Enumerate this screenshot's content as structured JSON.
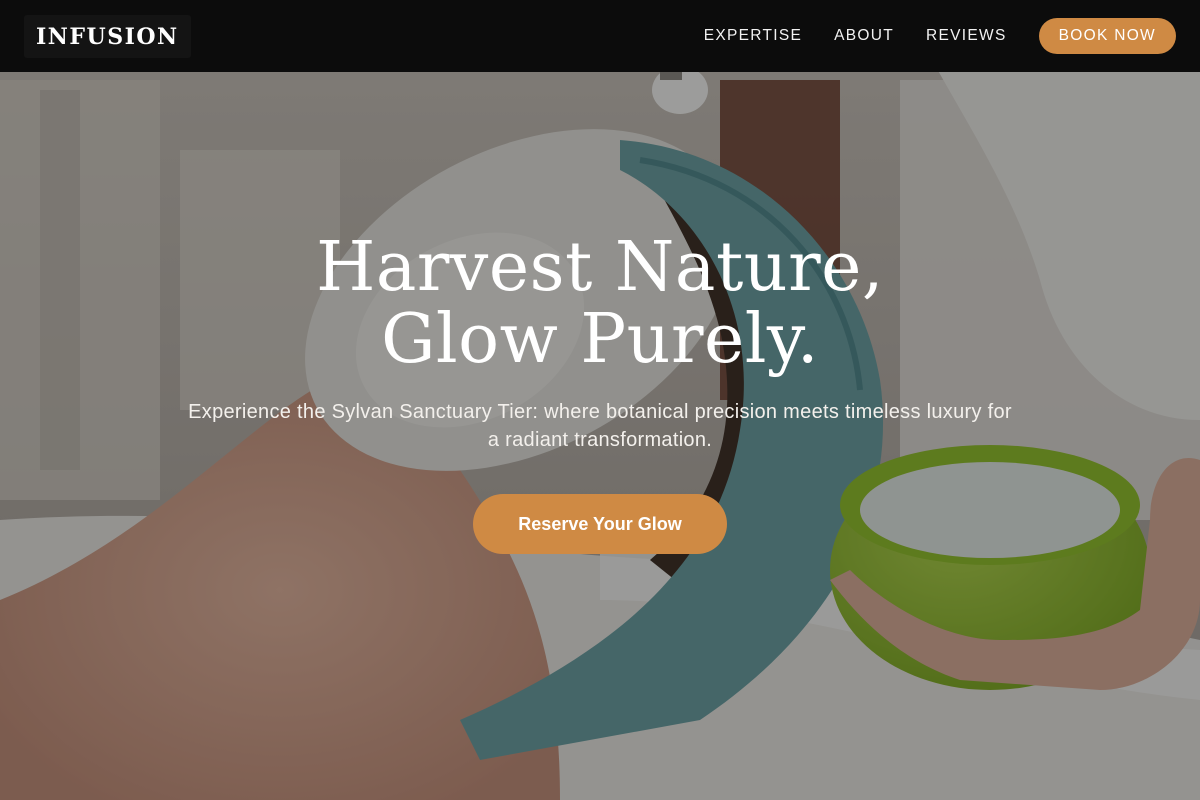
{
  "header": {
    "logo": "INFUSION",
    "nav": {
      "expertise": "EXPERTISE",
      "about": "ABOUT",
      "reviews": "REVIEWS"
    },
    "book_button": "BOOK NOW"
  },
  "hero": {
    "title": "Harvest Nature, Glow Purely.",
    "subtitle": "Experience the Sylvan Sanctuary Tier: where botanical precision meets timeless luxury for a radiant transformation.",
    "cta_label": "Reserve Your Glow",
    "background_image": "facial-treatment-photo"
  },
  "colors": {
    "accent": "#cf8a44",
    "navbar": "#0c0c0c",
    "text": "#ffffff"
  }
}
